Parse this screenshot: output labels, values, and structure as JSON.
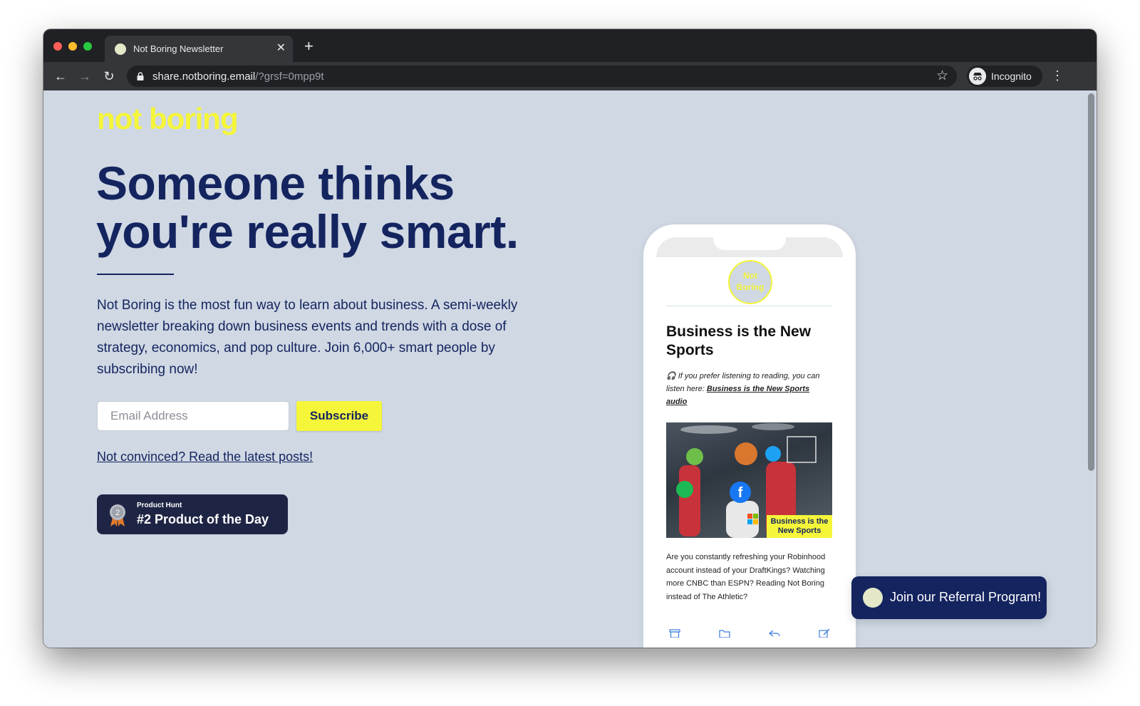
{
  "browser": {
    "tab_title": "Not Boring Newsletter",
    "tab_close": "✕",
    "new_tab": "+",
    "url_host": "share.notboring.email",
    "url_path": "/?grsf=0mpp9t",
    "profile_label": "Incognito",
    "back_glyph": "←",
    "forward_glyph": "→",
    "reload_glyph": "↻",
    "star_glyph": "☆",
    "menu_glyph": "⋮",
    "colors": {
      "frame": "#202124",
      "toolbar": "#35363a",
      "text": "#e8eaed"
    }
  },
  "page": {
    "logo": "not boring",
    "headline_line1": "Someone thinks",
    "headline_line2": "you're really smart.",
    "description": "Not Boring is the most fun way to learn about business. A semi-weekly newsletter breaking down business events and trends with a dose of strategy, economics, and pop culture. Join 6,000+ smart people by subscribing now!",
    "email_placeholder": "Email Address",
    "email_value": "",
    "subscribe_label": "Subscribe",
    "latest_link": "Not convinced? Read the latest posts!",
    "product_hunt": {
      "kicker": "Product Hunt",
      "title": "#2 Product of the Day",
      "medal_rank": "2"
    },
    "colors": {
      "background": "#cfd8e3",
      "navy": "#14245f",
      "accent_yellow": "#f5f53a"
    }
  },
  "phone_preview": {
    "avatar_text": "Not Boring",
    "title": "Business is the New Sports",
    "intro_prefix": "🎧 If you prefer listening to reading, you can listen here: ",
    "intro_link": "Business is the New Sports audio",
    "hero_caption": "Business is the New Sports",
    "body": "Are you constantly refreshing your Robinhood account instead of your DraftKings? Watching more CNBC than ESPN? Reading Not Boring instead of The Athletic?",
    "toolbar_icons": [
      "archive-icon",
      "folder-icon",
      "reply-icon",
      "compose-icon"
    ]
  },
  "referral": {
    "label": "Join our Referral Program!"
  }
}
